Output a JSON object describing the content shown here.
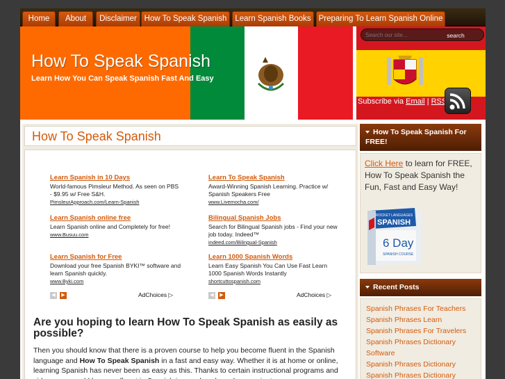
{
  "nav": {
    "items": [
      "Home",
      "About",
      "Disclaimer",
      "How To Speak Spanish",
      "Learn Spanish Books",
      "Preparing To Learn Spanish Online"
    ]
  },
  "header": {
    "title": "How To Speak Spanish",
    "tagline": "Learn How You Can Speak Spanish Fast And Easy",
    "search_placeholder": "Search our site...",
    "search_button": "search",
    "subscribe_prefix": "Subscribe via",
    "subscribe_email": "Email",
    "subscribe_separator": "|",
    "subscribe_rss": "RSS"
  },
  "post": {
    "title": "How To Speak Spanish",
    "heading": "Are you hoping to learn How To Speak Spanish as easily as possible?",
    "para_1": "Then you should know that there is a proven course to help you become fluent in the Spanish language and",
    "para_bold": "How To Speak Spanish",
    "para_2": "in a fast and easy way. Whether it is at home or online, learning Spanish has never been as easy as this. Thanks to certain instructional programs and videos, you could become fluent in Spanish in a no hassle and convenient way."
  },
  "ads": {
    "adchoices": "AdChoices",
    "left": [
      {
        "title": "Learn Spanish in 10 Days",
        "text": "World-famous Pimsleur Method. As seen on PBS - $9.95 w/ Free S&H.",
        "url": "PimsleurApproach.com/Learn-Spanish"
      },
      {
        "title": "Learn Spanish online free",
        "text": "Learn Spanish online and Completely for free!",
        "url": "www.Busuu.com"
      },
      {
        "title": "Learn Spanish for Free",
        "text": "Download your free Spanish BYKI™ software and learn Spanish quickly.",
        "url": "www.Byki.com"
      }
    ],
    "right": [
      {
        "title": "Learn To Speak Spanish",
        "text": "Award-Winning Spanish Learning. Practice w/ Spanish Speakers Free",
        "url": "www.Livemocha.com/"
      },
      {
        "title": "Bilingual Spanish Jobs",
        "text": "Search for Bilingual Spanish jobs - Find your new job today. Indeed™",
        "url": "indeed.com/Bilingual-Spanish"
      },
      {
        "title": "Learn 1000 Spanish Words",
        "text": "Learn Easy Spanish You Can Use Fast Learn 1000 Spanish Words Instantly",
        "url": "shortcuttospanish.com"
      }
    ]
  },
  "sidebar": {
    "promo_heading": "How To Speak Spanish For FREE!",
    "promo_link": "Click Here",
    "promo_text": "to learn for FREE, How To Speak Spanish the Fun, Fast and Easy Way!",
    "product_line1": "ROCKET LANGUAGES",
    "product_line2": "SPANISH",
    "product_line3": "6 Day",
    "product_line4": "SPANISH COURSE",
    "recent_heading": "Recent Posts",
    "recent_posts": [
      "Spanish Phrases For Teachers",
      "Spanish Phrases Learn",
      "Spanish Phrases For Travelers",
      "Spanish Phrases Dictionary Software",
      "Spanish Phrases Dictionary",
      "Spanish Phrases Dictionary"
    ]
  },
  "colors": {
    "accent": "#d35a09",
    "orange": "#ff6a00",
    "mexico_green": "#008a3a",
    "mexico_red": "#ea1a24",
    "spain_red": "#d4171f",
    "spain_yellow": "#ffd200"
  }
}
